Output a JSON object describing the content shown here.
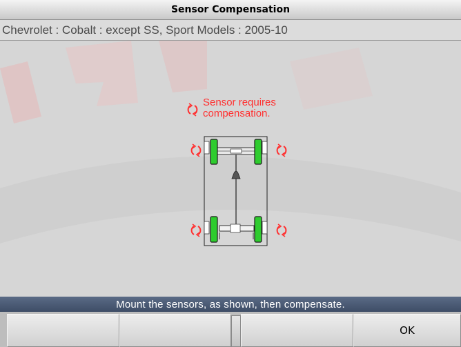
{
  "window": {
    "title": "Sensor Compensation"
  },
  "vehicle": {
    "description": "Chevrolet : Cobalt : except SS, Sport Models : 2005-10"
  },
  "diagram": {
    "note_line1": "Sensor requires",
    "note_line2": "compensation.",
    "icon": "rotate-arrows-icon",
    "wheel_color": "#2ecc2e",
    "arrow_color": "#ff3030"
  },
  "instruction": {
    "text": "Mount the sensors, as shown, then compensate."
  },
  "buttons": [
    {
      "label": ""
    },
    {
      "label": ""
    },
    {
      "label": ""
    },
    {
      "label": "OK"
    }
  ],
  "colors": {
    "background": "#d2d2d2",
    "instruction_bar": "#4a5a75",
    "watermark": "#e8bcbc"
  }
}
